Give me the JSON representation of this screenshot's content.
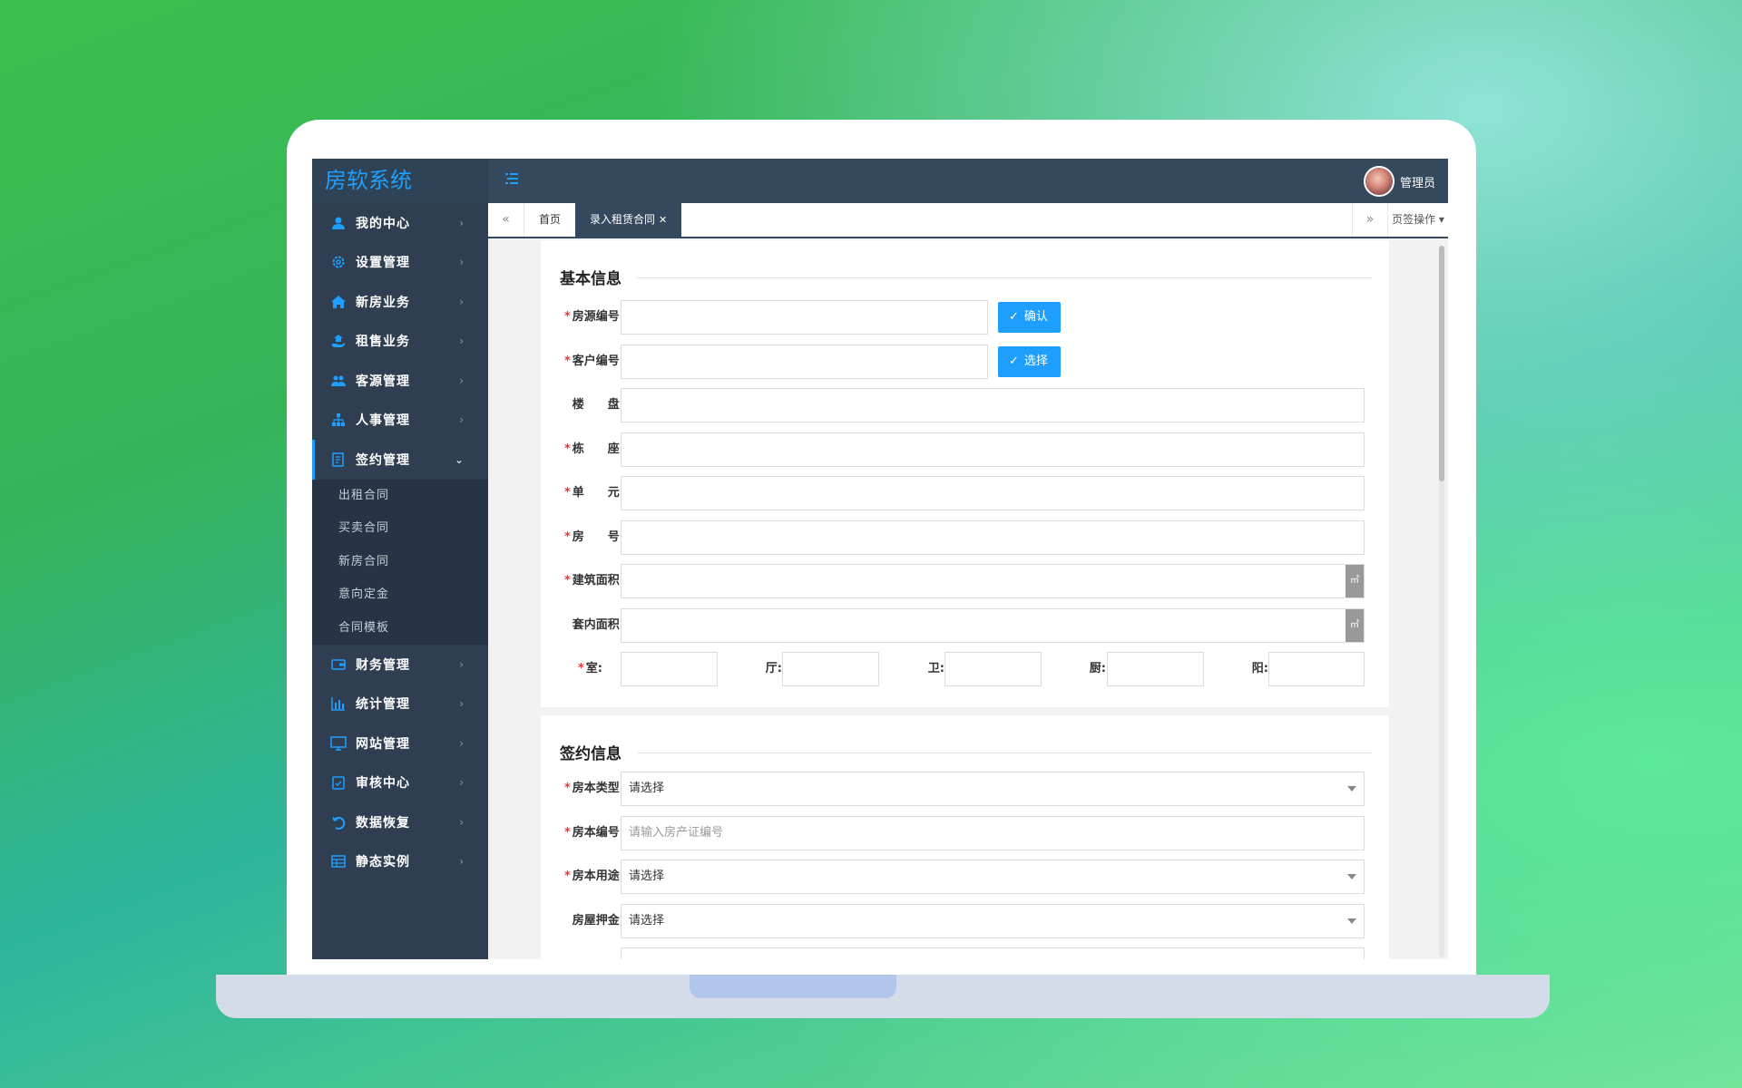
{
  "app": {
    "title": "房软系统",
    "user": "管理员"
  },
  "sidebar": {
    "items": [
      {
        "label": "我的中心",
        "icon": "user-icon"
      },
      {
        "label": "设置管理",
        "icon": "gear-icon"
      },
      {
        "label": "新房业务",
        "icon": "house-icon"
      },
      {
        "label": "租售业务",
        "icon": "hand-house-icon"
      },
      {
        "label": "客源管理",
        "icon": "users-icon"
      },
      {
        "label": "人事管理",
        "icon": "org-chart-icon"
      },
      {
        "label": "签约管理",
        "icon": "contract-icon"
      }
    ],
    "sub_items": [
      "出租合同",
      "买卖合同",
      "新房合同",
      "意向定金",
      "合同模板"
    ],
    "items_after": [
      {
        "label": "财务管理",
        "icon": "wallet-icon"
      },
      {
        "label": "统计管理",
        "icon": "bar-chart-icon"
      },
      {
        "label": "网站管理",
        "icon": "monitor-icon"
      },
      {
        "label": "审核中心",
        "icon": "clipboard-check-icon"
      },
      {
        "label": "数据恢复",
        "icon": "undo-icon"
      },
      {
        "label": "静态实例",
        "icon": "table-icon"
      }
    ]
  },
  "tabs": {
    "home": "首页",
    "active": "录入租赁合同",
    "page_ops": "页签操作"
  },
  "basic": {
    "title": "基本信息",
    "house_no": "房源编号:",
    "customer_no": "客户编号:",
    "confirm": "确认",
    "choose": "选择",
    "estate": "楼　　盘:",
    "building": "栋　　座:",
    "unit": "单　　元:",
    "room": "房　　号:",
    "build_area": "建筑面积:",
    "inner_area": "套内面积:",
    "area_unit": "㎡",
    "shi": "室:",
    "ting": "厅:",
    "wei": "卫:",
    "chu": "厨:",
    "yang": "阳:"
  },
  "sign": {
    "title": "签约信息",
    "deed_type": "房本类型:",
    "deed_no": "房本编号:",
    "deed_use": "房本用途:",
    "deposit": "房屋押金:",
    "select_placeholder": "请选择",
    "deed_no_placeholder": "请输入房产证编号"
  },
  "colors": {
    "topbar": "#34495e",
    "sidebar": "#2f3f51",
    "accent": "#1e9fff"
  }
}
